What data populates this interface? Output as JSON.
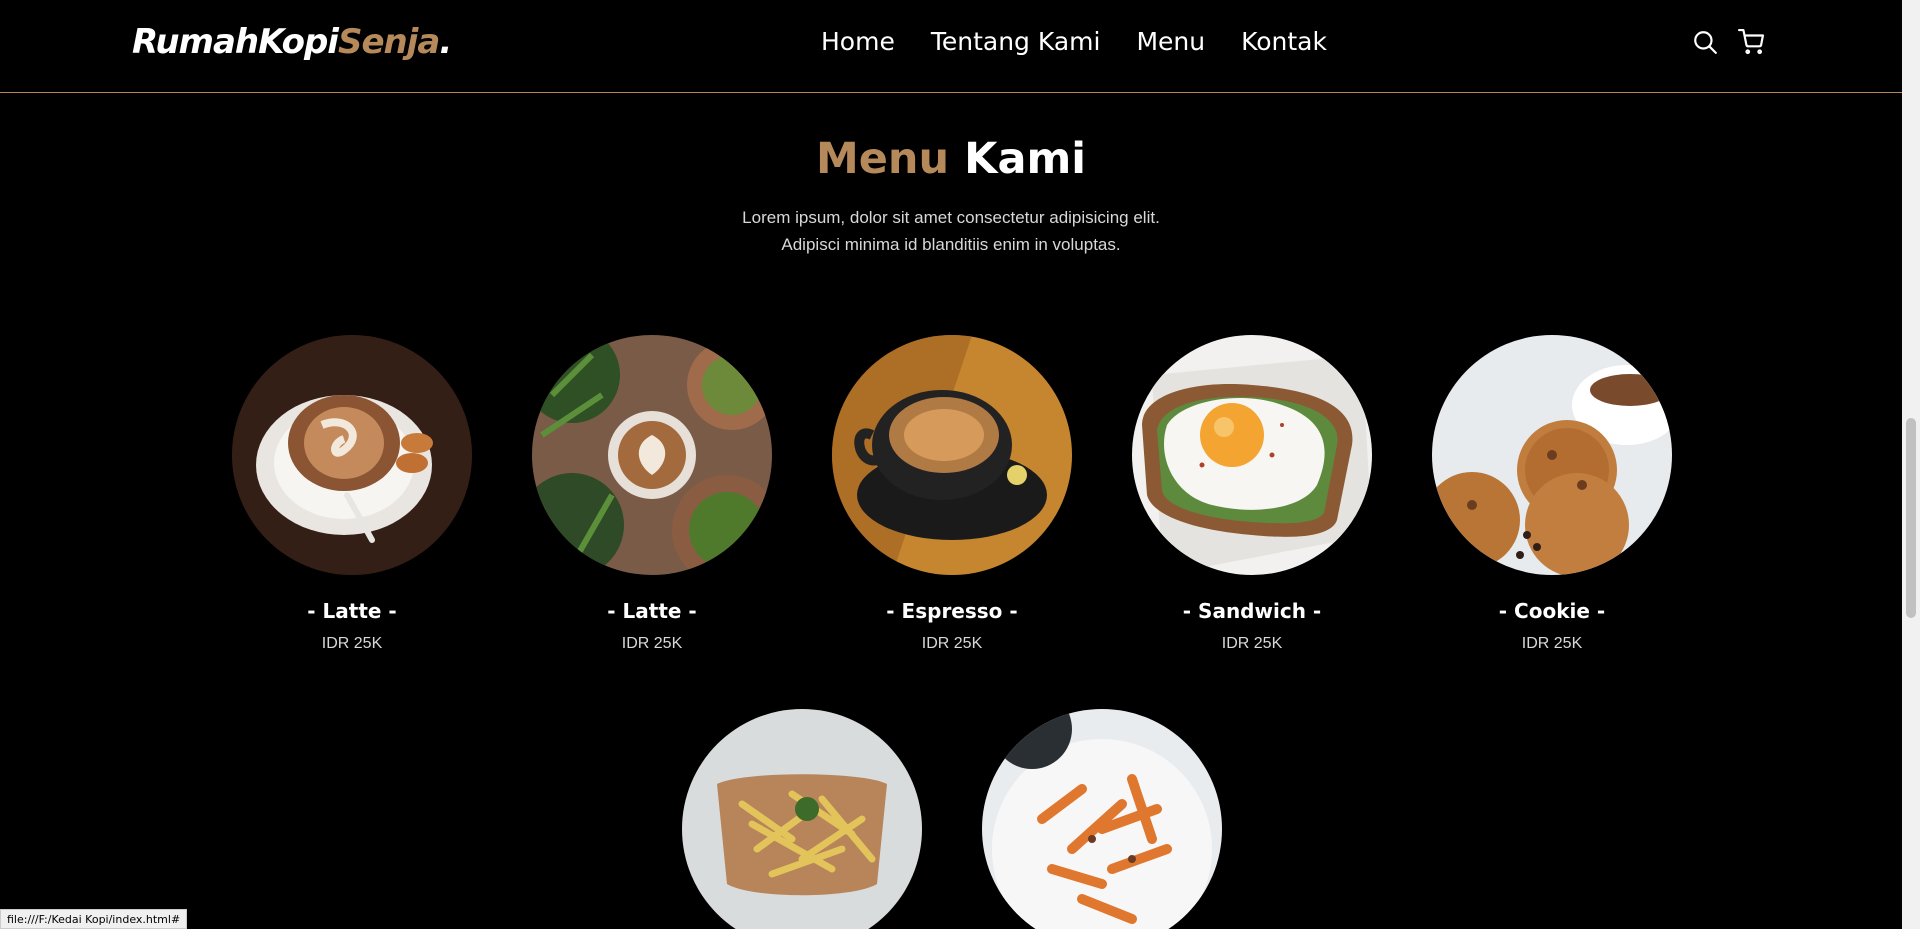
{
  "navbar": {
    "logo_main": "RumahKopi",
    "logo_accent": "Senja",
    "logo_dot": ".",
    "links": [
      "Home",
      "Tentang Kami",
      "Menu",
      "Kontak"
    ],
    "icons": [
      "search-icon",
      "cart-icon"
    ]
  },
  "menu_section": {
    "title_accent": "Menu",
    "title_main": "Kami",
    "desc_line1": "Lorem ipsum, dolor sit amet consectetur adipisicing elit.",
    "desc_line2": "Adipisci minima id blanditiis enim in voluptas.",
    "items": [
      {
        "name": "- Latte -",
        "price": "IDR 25K"
      },
      {
        "name": "- Latte -",
        "price": "IDR 25K"
      },
      {
        "name": "- Espresso -",
        "price": "IDR 25K"
      },
      {
        "name": "- Sandwich -",
        "price": "IDR 25K"
      },
      {
        "name": "- Cookie -",
        "price": "IDR 25K"
      }
    ]
  },
  "status_bar": {
    "url": "file:///F:/Kedai Kopi/index.html#"
  },
  "colors": {
    "accent": "#b6895b",
    "background": "#000000",
    "text": "#ffffff"
  }
}
